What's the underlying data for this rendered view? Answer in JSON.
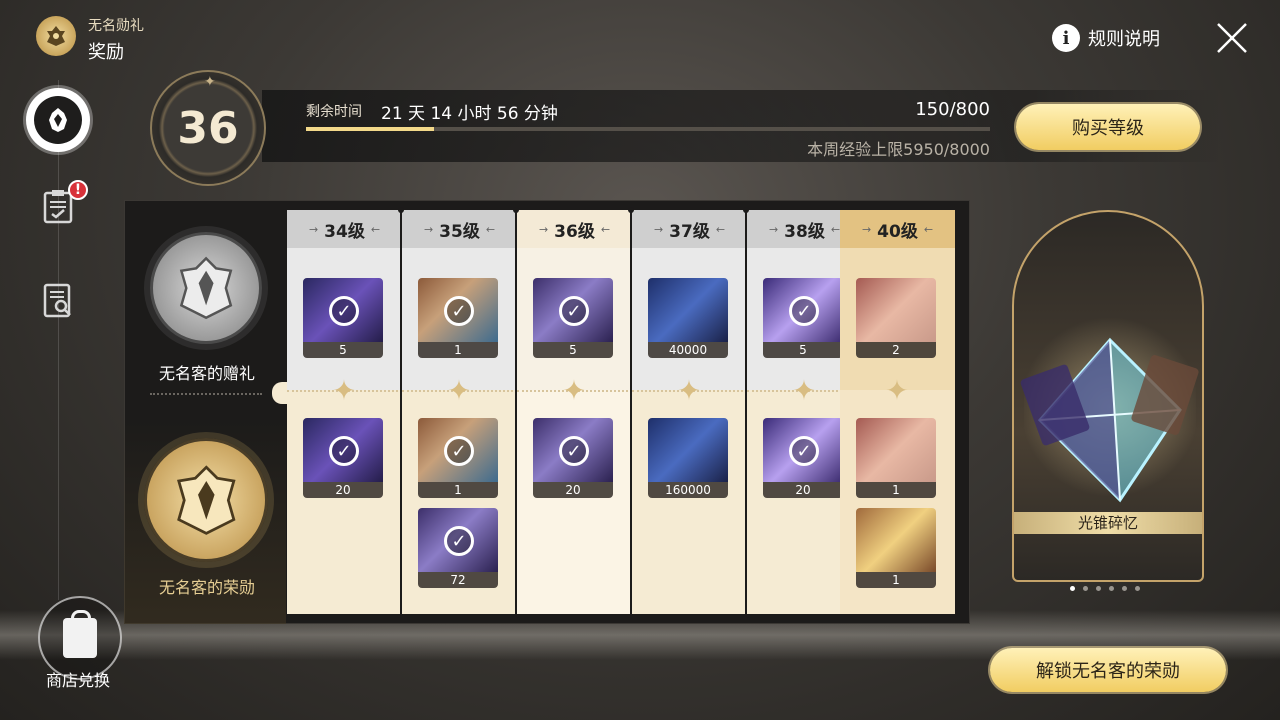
{
  "header": {
    "subtitle": "无名勋礼",
    "title": "奖励",
    "rules_label": "规则说明"
  },
  "sidebar": {
    "shop_label": "商店兑换",
    "alert_badge": "!"
  },
  "level": {
    "current": "36",
    "time_label": "剩余时间",
    "time_remaining": "21 天 14 小时 56 分钟",
    "exp_text": "150/800",
    "exp_fraction": 0.1875,
    "weekly_cap_text": "本周经验上限5950/8000",
    "buy_button": "购买等级"
  },
  "tracks": {
    "free_label": "无名客的赠礼",
    "paid_label": "无名客的荣勋"
  },
  "columns": [
    {
      "header": "34级",
      "free": [
        {
          "count": "5",
          "art": "purple",
          "claimed": true
        }
      ],
      "paid": [
        {
          "count": "20",
          "art": "purple",
          "claimed": true
        }
      ]
    },
    {
      "header": "35级",
      "free": [
        {
          "count": "1",
          "art": "brown",
          "claimed": true
        }
      ],
      "paid": [
        {
          "count": "1",
          "art": "brown",
          "claimed": true
        },
        {
          "count": "72",
          "art": "violet",
          "claimed": true
        }
      ]
    },
    {
      "header": "36级",
      "free": [
        {
          "count": "5",
          "art": "violet",
          "claimed": true
        }
      ],
      "paid": [
        {
          "count": "20",
          "art": "violet",
          "claimed": true
        }
      ]
    },
    {
      "header": "37级",
      "free": [
        {
          "count": "40000",
          "art": "blue",
          "claimed": false
        }
      ],
      "paid": [
        {
          "count": "160000",
          "art": "blue",
          "claimed": false
        }
      ]
    },
    {
      "header": "38级",
      "free": [
        {
          "count": "5",
          "art": "starpurple",
          "claimed": true
        }
      ],
      "paid": [
        {
          "count": "20",
          "art": "starpurple",
          "claimed": true
        }
      ]
    },
    {
      "header": "40级",
      "free": [
        {
          "count": "2",
          "art": "rose",
          "claimed": false
        }
      ],
      "paid": [
        {
          "count": "1",
          "art": "rose",
          "claimed": false
        },
        {
          "count": "1",
          "art": "gold",
          "claimed": false
        }
      ]
    }
  ],
  "showcase": {
    "label": "光锥碎忆",
    "page_count": 6,
    "page_active": 0
  },
  "unlock_button": "解锁无名客的荣勋",
  "colors": {
    "accent_gold": "#f1cd62",
    "panel_dark": "#1c1b1a",
    "alert_red": "#d8323a"
  }
}
